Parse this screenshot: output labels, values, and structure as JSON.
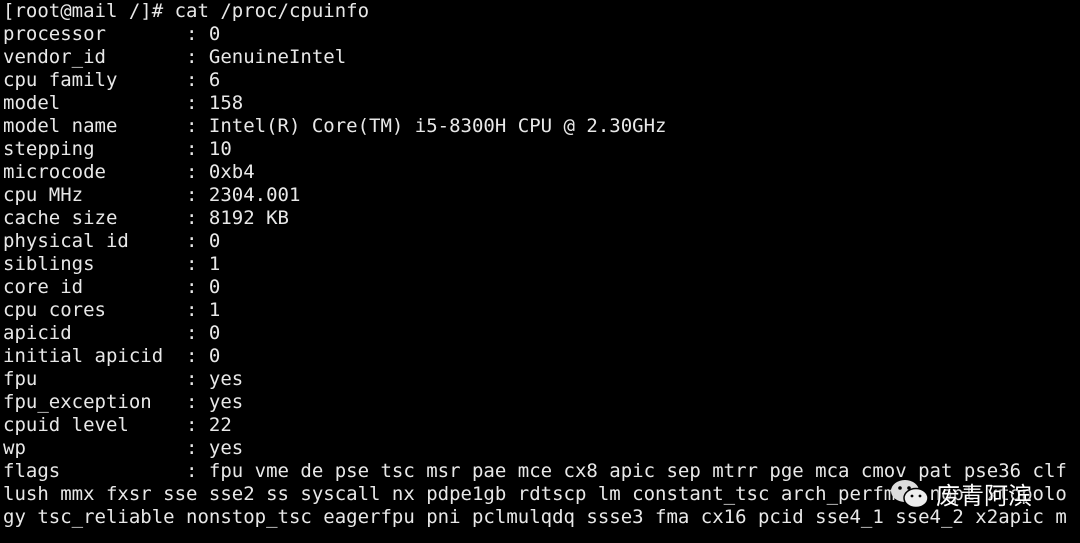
{
  "terminal": {
    "lines": [
      "[root@mail /]# cat /proc/cpuinfo",
      "processor       : 0",
      "vendor_id       : GenuineIntel",
      "cpu family      : 6",
      "model           : 158",
      "model name      : Intel(R) Core(TM) i5-8300H CPU @ 2.30GHz",
      "stepping        : 10",
      "microcode       : 0xb4",
      "cpu MHz         : 2304.001",
      "cache size      : 8192 KB",
      "physical id     : 0",
      "siblings        : 1",
      "core id         : 0",
      "cpu cores       : 1",
      "apicid          : 0",
      "initial apicid  : 0",
      "fpu             : yes",
      "fpu_exception   : yes",
      "cpuid level     : 22",
      "wp              : yes",
      "flags           : fpu vme de pse tsc msr pae mce cx8 apic sep mtrr pge mca cmov pat pse36 clf",
      "lush mmx fxsr sse sse2 ss syscall nx pdpe1gb rdtscp lm constant_tsc arch_perfmon nopl xtopolo",
      "gy tsc_reliable nonstop_tsc eagerfpu pni pclmulqdq ssse3 fma cx16 pcid sse4_1 sse4_2 x2apic m"
    ]
  },
  "watermark": {
    "text": "废青阿滨",
    "icon": "wechat-icon"
  }
}
